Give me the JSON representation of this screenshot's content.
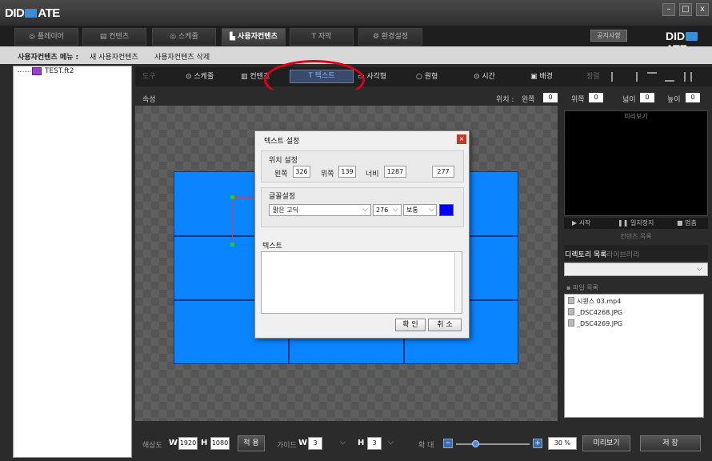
{
  "app": {
    "logo": "DIDMATE",
    "logo_left": "DID",
    "logo_right": "ATE",
    "win_min": "–",
    "win_max": "□",
    "win_close": "x"
  },
  "tabs": [
    {
      "label": "◎ 플레이어"
    },
    {
      "label": "▤ 컨텐츠"
    },
    {
      "label": "◎ 스케줄"
    },
    {
      "label": "▙ 사용자컨텐츠"
    },
    {
      "label": "T 자막"
    },
    {
      "label": "⚙ 환경설정"
    }
  ],
  "notice_label": "공지사항",
  "menu": {
    "title": "사용자컨텐츠 메뉴 :",
    "new": "새 사용자컨텐츠",
    "delete": "사용자컨텐츠 삭제"
  },
  "tree": {
    "file": "TEST.ft2"
  },
  "toolbar": {
    "tools": "도구",
    "schedule": "⊙ 스케줄",
    "contents": "▥ 컨텐츠",
    "text": "T 텍스트",
    "rect": "▭ 사각형",
    "circle": "○ 원형",
    "time": "⊙ 시간",
    "background": "▣ 배경",
    "align": "정렬"
  },
  "props": {
    "label": "속성",
    "position_label": "위치 :",
    "left_label": "왼쪽",
    "left_value": "0",
    "top_label": "위쪽",
    "top_value": "0",
    "width_label": "넓이",
    "width_value": "0",
    "height_label": "높이",
    "height_value": "0"
  },
  "preview": {
    "label": "미리보기",
    "play": "▶ 시작",
    "pause": "❚❚ 일지정지",
    "stop": "■ 멈춤"
  },
  "content_list": {
    "title": "컨텐츠 목록",
    "tab_dir": "디렉토리 목록",
    "tab_lib": "라이브러리",
    "files_title": "▪ 파일 목록"
  },
  "files": [
    {
      "name": "시퀀스 03.mp4"
    },
    {
      "name": "_DSC4268.JPG"
    },
    {
      "name": "_DSC4269.JPG"
    }
  ],
  "bottom": {
    "resolution_label": "해상도",
    "w_label": "W",
    "w_value": "1920",
    "h_label": "H",
    "h_value": "1080",
    "apply": "적 용",
    "guide_label": "가이드",
    "guide_w_label": "W",
    "guide_w_value": "3",
    "guide_h_label": "H",
    "guide_h_value": "3",
    "zoom_label": "확 대",
    "zoom_value": "30 %",
    "preview_btn": "미리보기",
    "save_btn": "저 장"
  },
  "dialog": {
    "title": "텍스트 설정",
    "position_group": "위치 설정",
    "left_label": "왼쪽",
    "left_value": "326",
    "top_label": "위쪽",
    "top_value": "139",
    "width_label": "너비",
    "width_value": "1287",
    "height_value": "277",
    "font_group": "글꼴설정",
    "font_name": "맑은 고딕",
    "font_size": "276",
    "font_style": "보통",
    "font_color": "#0000ff",
    "text_group": "텍스트",
    "ok": "확 인",
    "cancel": "취 소"
  }
}
